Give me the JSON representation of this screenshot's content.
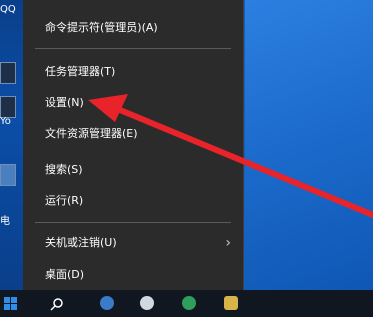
{
  "desktop": {
    "labels": [
      "QQ",
      "Yo",
      "电"
    ]
  },
  "context_menu": {
    "items": [
      {
        "label": "命令提示符(管理员)(A)"
      },
      {
        "label": "任务管理器(T)"
      },
      {
        "label": "设置(N)"
      },
      {
        "label": "文件资源管理器(E)"
      },
      {
        "label": "搜索(S)"
      },
      {
        "label": "运行(R)"
      },
      {
        "label": "关机或注销(U)",
        "submenu_icon": "chevron-right-icon"
      },
      {
        "label": "桌面(D)"
      }
    ]
  },
  "annotation": {
    "arrow_color": "#e8232a",
    "points_to": "设置(N)"
  },
  "taskbar": {
    "icons": [
      "windows-start-icon",
      "search-icon",
      "app-icon",
      "app-icon",
      "app-icon",
      "app-icon"
    ]
  },
  "colors": {
    "menu_background": "#2b2b2b",
    "desktop_blue": "#1560c0",
    "taskbar": "#101720"
  }
}
